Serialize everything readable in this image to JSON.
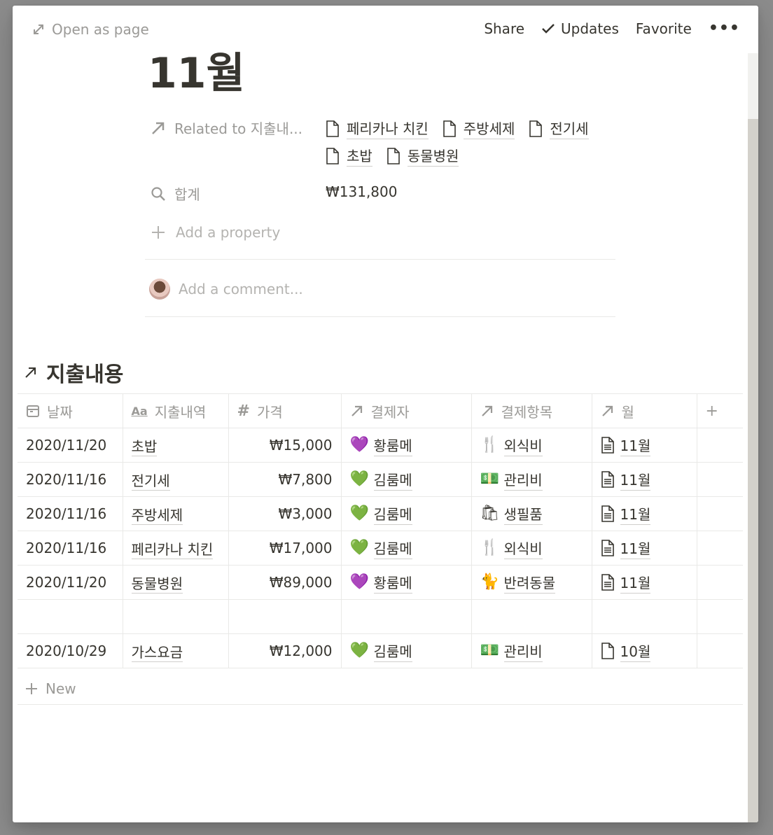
{
  "topbar": {
    "open_as_page": "Open as page",
    "share": "Share",
    "updates": "Updates",
    "favorite": "Favorite",
    "more": "•••"
  },
  "page": {
    "title": "11월",
    "properties": {
      "related": {
        "name": "Related to 지출내...",
        "items": [
          "페리카나 치킨",
          "주방세제",
          "전기세",
          "초밥",
          "동물병원"
        ]
      },
      "total": {
        "name": "합계",
        "value": "₩131,800"
      },
      "add_property": "Add a property"
    },
    "comment_placeholder": "Add a comment..."
  },
  "section": {
    "title": "지출내용"
  },
  "table": {
    "columns": [
      "날짜",
      "지출내역",
      "가격",
      "결제자",
      "결제항목",
      "월"
    ],
    "rows": [
      {
        "date": "2020/11/20",
        "item": "초밥",
        "price": "₩15,000",
        "payer": "황룸메",
        "payer_icon": "💜",
        "category": "외식비",
        "category_icon": "🍴",
        "month": "11월"
      },
      {
        "date": "2020/11/16",
        "item": "전기세",
        "price": "₩7,800",
        "payer": "김룸메",
        "payer_icon": "💚",
        "category": "관리비",
        "category_icon": "💵",
        "month": "11월"
      },
      {
        "date": "2020/11/16",
        "item": "주방세제",
        "price": "₩3,000",
        "payer": "김룸메",
        "payer_icon": "💚",
        "category": "생필품",
        "category_icon": "🛍",
        "month": "11월"
      },
      {
        "date": "2020/11/16",
        "item": "페리카나 치킨",
        "price": "₩17,000",
        "payer": "김룸메",
        "payer_icon": "💚",
        "category": "외식비",
        "category_icon": "🍴",
        "month": "11월"
      },
      {
        "date": "2020/11/20",
        "item": "동물병원",
        "price": "₩89,000",
        "payer": "황룸메",
        "payer_icon": "💜",
        "category": "반려동물",
        "category_icon": "🐈",
        "month": "11월"
      },
      {
        "date": "",
        "item": "",
        "price": "",
        "payer": "",
        "payer_icon": "",
        "category": "",
        "category_icon": "",
        "month": ""
      },
      {
        "date": "2020/10/29",
        "item": "가스요금",
        "price": "₩12,000",
        "payer": "김룸메",
        "payer_icon": "💚",
        "category": "관리비",
        "category_icon": "💵",
        "month": "10월"
      }
    ],
    "new_label": "New"
  }
}
